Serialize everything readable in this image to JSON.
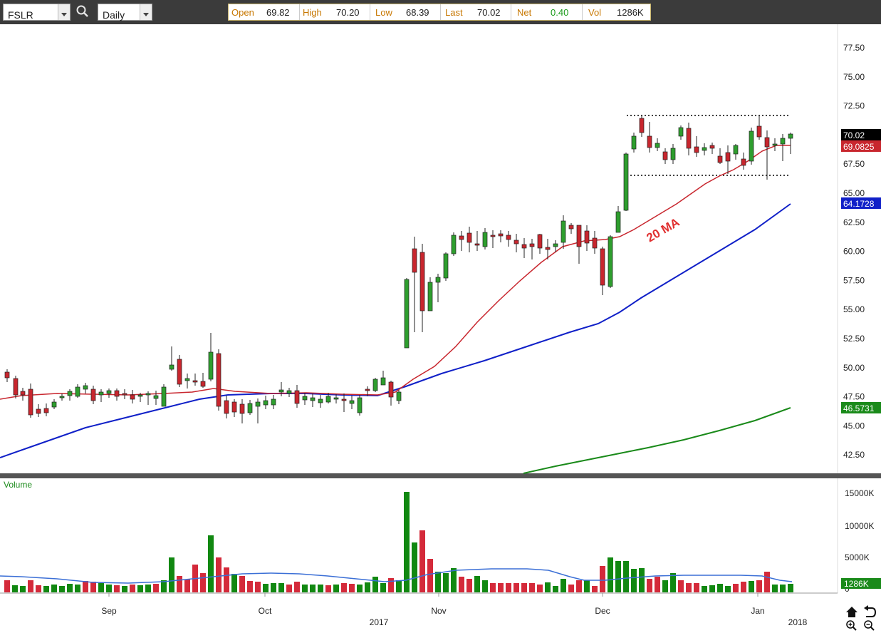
{
  "toolbar": {
    "symbol": "FSLR",
    "period": "Daily",
    "quote": [
      {
        "label": "Open",
        "value": "69.82"
      },
      {
        "label": "High",
        "value": "70.20"
      },
      {
        "label": "Low",
        "value": "68.39"
      },
      {
        "label": "Last",
        "value": "70.02"
      },
      {
        "label": "Net",
        "value": "0.40"
      },
      {
        "label": "Vol",
        "value": "1286K"
      }
    ]
  },
  "price_axis": [
    "77.50",
    "75.00",
    "72.50",
    "70.00",
    "67.50",
    "65.00",
    "62.50",
    "60.00",
    "57.50",
    "55.00",
    "52.50",
    "50.00",
    "47.50",
    "45.00",
    "42.50"
  ],
  "price_tags": {
    "last": "70.02",
    "ma20": "69.0825",
    "ma50": "64.1728",
    "ma200": "46.5731"
  },
  "annotation": "20 MA",
  "volume": {
    "title": "Volume",
    "axis": [
      "15000K",
      "10000K",
      "5000K",
      "0"
    ],
    "tag": "1286K"
  },
  "date_axis": {
    "months": [
      "Sep",
      "Oct",
      "Nov",
      "Dec",
      "Jan"
    ],
    "years": [
      "2017",
      "2018"
    ]
  },
  "colors": {
    "up": "#2e9e2e",
    "down": "#c8262e",
    "ma20": "#c8262e",
    "ma50": "#1020c8",
    "ma200": "#1a8a1a",
    "volMa": "#3b6fd6"
  },
  "icons": [
    "search-icon",
    "home-icon",
    "undo-icon",
    "zoom-in-icon",
    "zoom-out-icon"
  ]
}
